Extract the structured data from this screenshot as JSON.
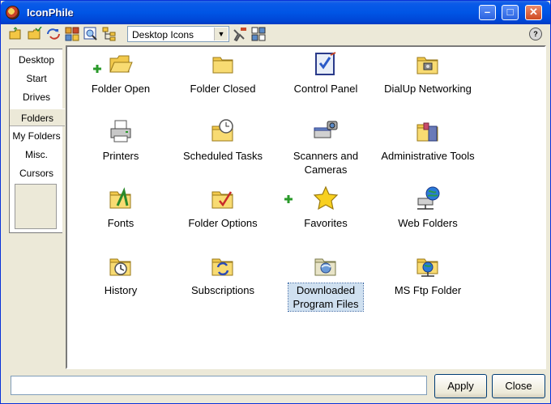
{
  "window": {
    "title": "IconPhile",
    "min_glyph": "–",
    "max_glyph": "□",
    "close_glyph": "✕"
  },
  "toolbar": {
    "dropdown_value": "Desktop Icons",
    "dropdown_arrow": "▼",
    "help_glyph": "?"
  },
  "tabs": [
    {
      "label": "Desktop"
    },
    {
      "label": "Start"
    },
    {
      "label": "Drives"
    },
    {
      "label": "Folders"
    },
    {
      "label": "My Folders"
    },
    {
      "label": "Misc."
    },
    {
      "label": "Cursors"
    }
  ],
  "selected_tab": "Folders",
  "icons": [
    {
      "label": "Folder Open",
      "icon": "folder-open-icon"
    },
    {
      "label": "Folder Closed",
      "icon": "folder-closed-icon"
    },
    {
      "label": "Control Panel",
      "icon": "control-panel-icon"
    },
    {
      "label": "DialUp Networking",
      "icon": "dialup-networking-icon"
    },
    {
      "label": "Printers",
      "icon": "printers-icon"
    },
    {
      "label": "Scheduled Tasks",
      "icon": "scheduled-tasks-icon"
    },
    {
      "label": "Scanners and Cameras",
      "icon": "scanners-cameras-icon"
    },
    {
      "label": "Administrative Tools",
      "icon": "administrative-tools-icon"
    },
    {
      "label": "Fonts",
      "icon": "fonts-icon"
    },
    {
      "label": "Folder Options",
      "icon": "folder-options-icon"
    },
    {
      "label": "Favorites",
      "icon": "favorites-icon"
    },
    {
      "label": "Web Folders",
      "icon": "web-folders-icon"
    },
    {
      "label": "History",
      "icon": "history-icon"
    },
    {
      "label": "Subscriptions",
      "icon": "subscriptions-icon"
    },
    {
      "label": "Downloaded Program Files",
      "icon": "downloaded-program-files-icon"
    },
    {
      "label": "MS Ftp Folder",
      "icon": "ms-ftp-folder-icon"
    }
  ],
  "selected_icon": "Downloaded Program Files",
  "status_text": "",
  "buttons": {
    "apply_label": "Apply",
    "close_label": "Close"
  }
}
